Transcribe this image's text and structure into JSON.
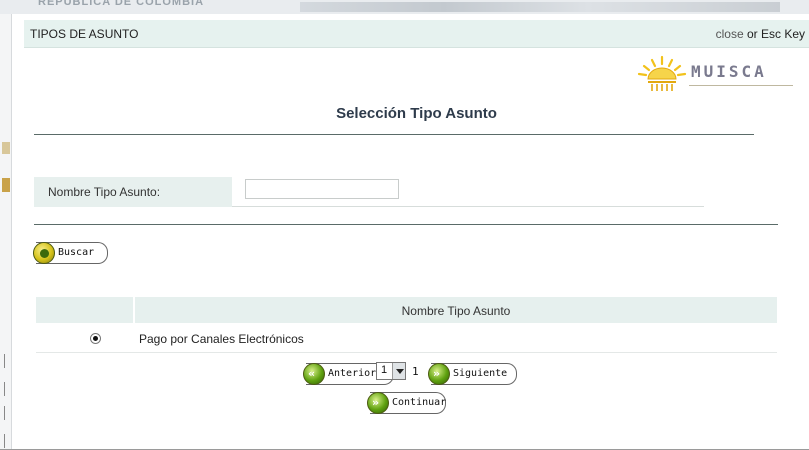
{
  "background": {
    "header_text": "REPUBLICA DE COLOMBIA"
  },
  "modal": {
    "title": "TIPOS DE ASUNTO",
    "close_link": "close",
    "close_or": " or ",
    "close_key": "Esc Key"
  },
  "logo": {
    "word": "MUISCA"
  },
  "page": {
    "heading": "Selección Tipo Asunto"
  },
  "search": {
    "label": "Nombre Tipo Asunto:",
    "value": "",
    "button_label": "Buscar"
  },
  "grid": {
    "column_header": "Nombre Tipo Asunto",
    "rows": [
      {
        "selected": true,
        "name": "Pago por Canales Electrónicos"
      }
    ]
  },
  "pager": {
    "prev_label": "Anterior",
    "page_select_value": "1",
    "page_count": "1",
    "next_label": "Siguiente",
    "continue_label": "Continuar"
  },
  "colors": {
    "header_bg": "#e6f2ef",
    "heading_text": "#2e3b4b",
    "button_icon_green": "#5fa10f",
    "button_icon_yellow": "#d5c219"
  },
  "icons": {
    "search_button_icon": "circle-icon",
    "prev_icon": "double-chevron-left-icon",
    "next_icon": "double-chevron-right-icon",
    "continue_icon": "double-chevron-right-icon",
    "logo_icon": "sun-icon"
  }
}
